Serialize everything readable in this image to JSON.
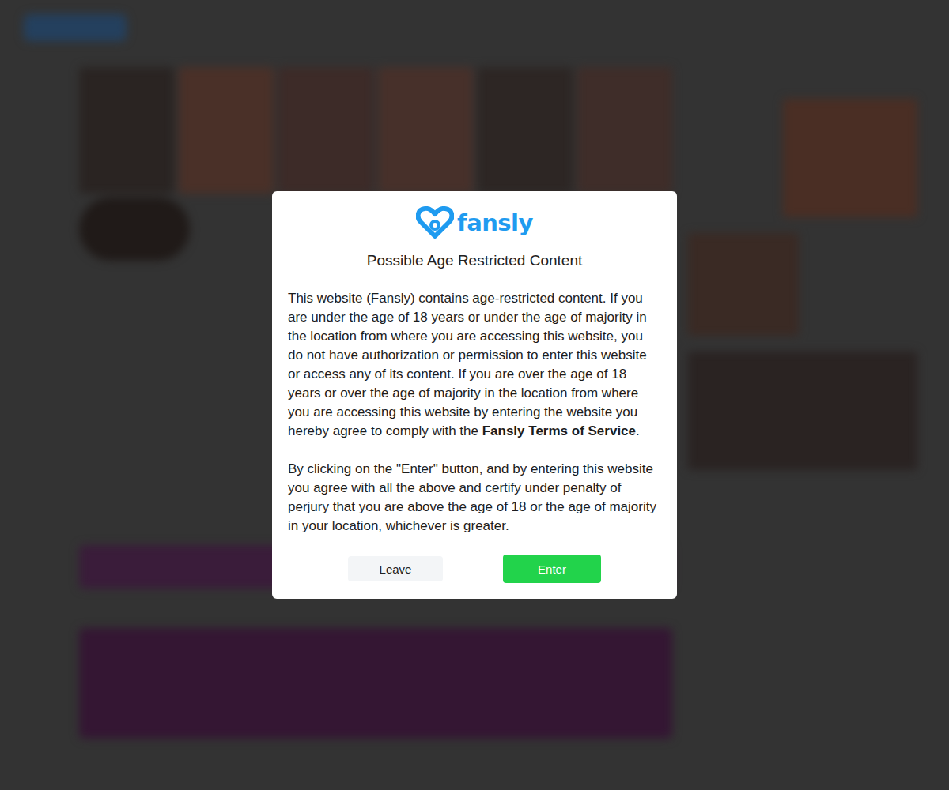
{
  "logo": {
    "text": "fansly"
  },
  "dialog": {
    "title": "Possible Age Restricted Content",
    "paragraph1": {
      "before": "This website (Fansly) contains age-restricted content. If you are under the age of 18 years or under the age of majority in the location from where you are accessing this website, you do not have authorization or permission to enter this website or access any of its content. If you are over the age of 18 years or over the age of majority in the location from where you are accessing this website by entering the website you hereby agree to comply with the ",
      "link": "Fansly Terms of Service",
      "after": "."
    },
    "paragraph2": "By clicking on the \"Enter\" button, and by entering this website you agree with all the above and certify under penalty of perjury that you are above the age of 18 or the age of majority in your location, whichever is greater.",
    "buttons": [
      {
        "label": "Leave",
        "kind": "secondary"
      },
      {
        "label": "Enter",
        "kind": "primary"
      }
    ]
  }
}
